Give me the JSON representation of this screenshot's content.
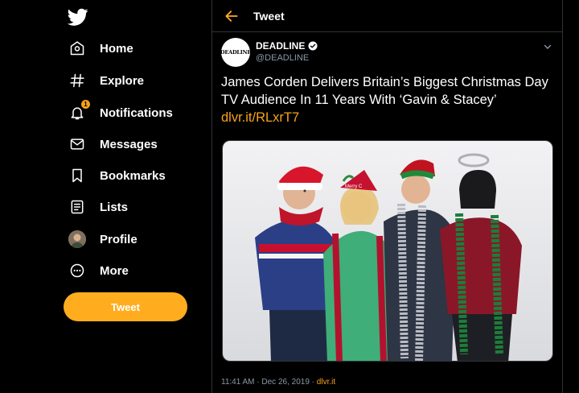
{
  "sidebar": {
    "items": [
      {
        "label": "Home",
        "icon": "home-icon"
      },
      {
        "label": "Explore",
        "icon": "hashtag-icon"
      },
      {
        "label": "Notifications",
        "icon": "bell-icon",
        "badge": "1"
      },
      {
        "label": "Messages",
        "icon": "envelope-icon"
      },
      {
        "label": "Bookmarks",
        "icon": "bookmark-icon"
      },
      {
        "label": "Lists",
        "icon": "list-icon"
      },
      {
        "label": "Profile",
        "icon": "avatar"
      },
      {
        "label": "More",
        "icon": "more-icon"
      }
    ],
    "tweet_button": "Tweet"
  },
  "header": {
    "title": "Tweet"
  },
  "tweet": {
    "author_name": "DEADLINE",
    "author_handle": "@DEADLINE",
    "avatar_text": "DEADLINE",
    "text": "James Corden Delivers Britain’s Biggest Christmas Day TV Audience In 11 Years With ‘Gavin & Stacey’",
    "link": "dlvr.it/RLxrT7",
    "timestamp": "11:41 AM · Dec 26, 2019 · ",
    "source": "dlvr.it"
  },
  "colors": {
    "accent": "#ffad1f",
    "link": "#f7a21b",
    "background": "#000000",
    "muted": "#8899a6"
  }
}
